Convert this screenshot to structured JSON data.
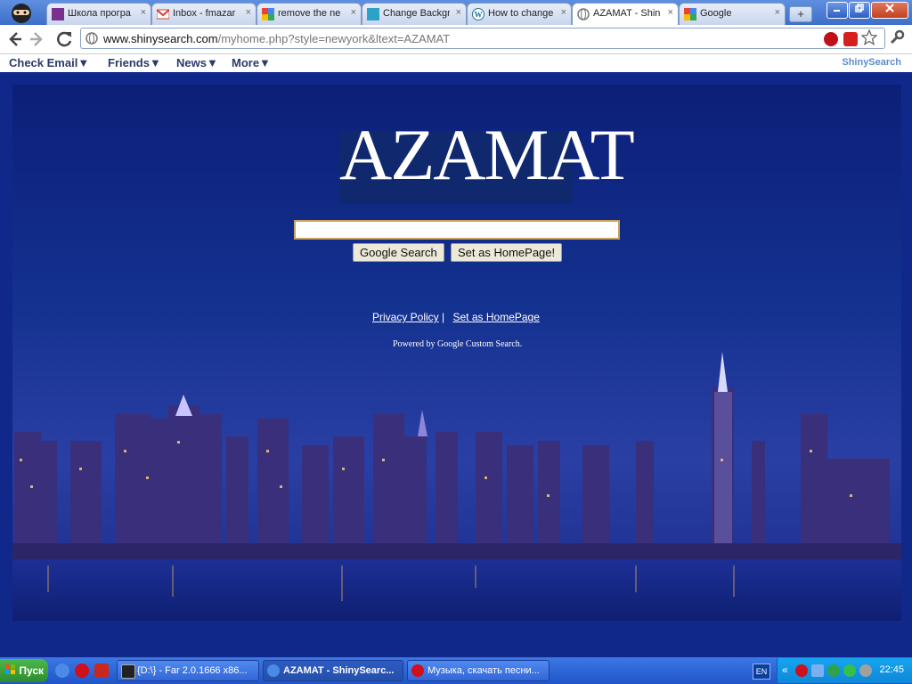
{
  "browser": {
    "tabs": [
      {
        "title": "Школа програ",
        "icon": "book-icon",
        "color": "#7b2f8c"
      },
      {
        "title": "Inbox - fmazar",
        "icon": "gmail-icon",
        "color": "#d54135"
      },
      {
        "title": "remove the ne",
        "icon": "google-icon",
        "color": "#4285f4"
      },
      {
        "title": "Change Backgr",
        "icon": "page-icon",
        "color": "#2aa2c9"
      },
      {
        "title": "How to change",
        "icon": "wordpress-icon",
        "color": "#21759b"
      },
      {
        "title": "AZAMAT - Shin",
        "icon": "globe-icon",
        "color": "#7a7a7a"
      },
      {
        "title": "Google",
        "icon": "google-icon",
        "color": "#4285f4"
      }
    ],
    "close_glyph": "×",
    "new_tab_glyph": "+",
    "url_host": "www.shinysearch.com",
    "url_path": "/myhome.php?style=newyork&ltext=AZAMAT"
  },
  "menubar": {
    "items": [
      "Check Email▼",
      "Friends▼",
      "News▼",
      "More▼"
    ],
    "brand": "ShinySearch"
  },
  "page": {
    "logo_text": "AZAMAT",
    "search_value": "",
    "search_button": "Google Search",
    "homepage_button": "Set as HomePage!",
    "privacy_link": "Privacy Policy",
    "separator": "|",
    "homepage_link": "Set as HomePage",
    "powered_by": "Powered by Google Custom Search."
  },
  "taskbar": {
    "start_label": "Пуск",
    "tasks": [
      {
        "label": "{D:\\} - Far 2.0.1666 x86...",
        "icon": "far-icon",
        "color": "#222"
      },
      {
        "label": "AZAMAT - ShinySearc...",
        "icon": "chrome-icon",
        "color": "#4a8ae8"
      },
      {
        "label": "Музыка, скачать песни...",
        "icon": "opera-icon",
        "color": "#d0101a"
      }
    ],
    "language": "EN",
    "tray_prefix": "«",
    "clock": "22:45"
  }
}
